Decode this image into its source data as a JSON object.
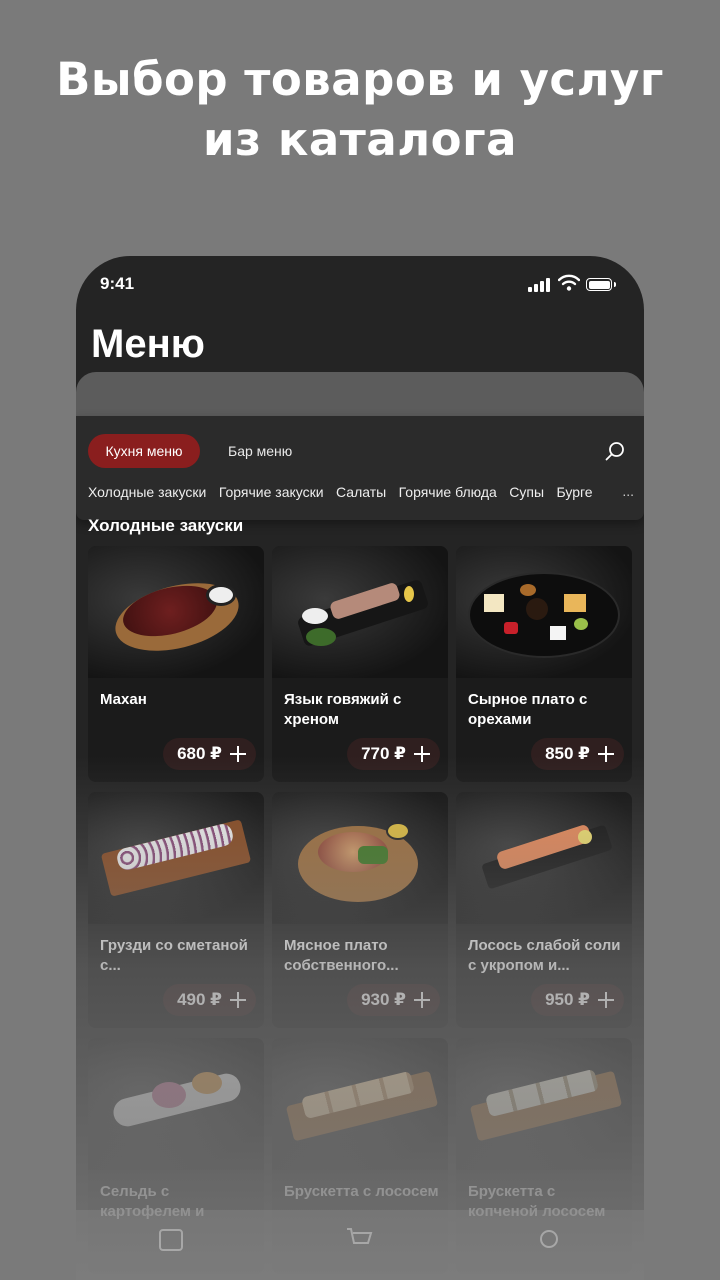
{
  "headline": {
    "line1": "Выбор товаров и услуг",
    "line2": "из каталога"
  },
  "status_bar": {
    "time": "9:41"
  },
  "page_title": "Меню",
  "menu_tabs": [
    {
      "label": "Кухня меню",
      "active": true
    },
    {
      "label": "Бар меню",
      "active": false
    }
  ],
  "categories": [
    "Холодные закуски",
    "Горячие закуски",
    "Салаты",
    "Горячие блюда",
    "Супы",
    "Бурге"
  ],
  "categories_more": "...",
  "section_title": "Холодные закуски",
  "accent_color": "#8a1e1e",
  "products": [
    {
      "name": "Махан",
      "price": "680 ₽"
    },
    {
      "name": "Язык говяжий с хреном",
      "price": "770 ₽"
    },
    {
      "name": "Сырное плато с орехами",
      "price": "850 ₽"
    },
    {
      "name": "Грузди со сметаной с...",
      "price": "490 ₽"
    },
    {
      "name": "Мясное плато собственного...",
      "price": "930 ₽"
    },
    {
      "name": "Лосось слабой соли с укропом и...",
      "price": "950 ₽"
    },
    {
      "name": "Сельдь с картофелем и",
      "price": ""
    },
    {
      "name": "Брускетта с лососем",
      "price": ""
    },
    {
      "name": "Брускетта с копченой лососем",
      "price": ""
    }
  ]
}
